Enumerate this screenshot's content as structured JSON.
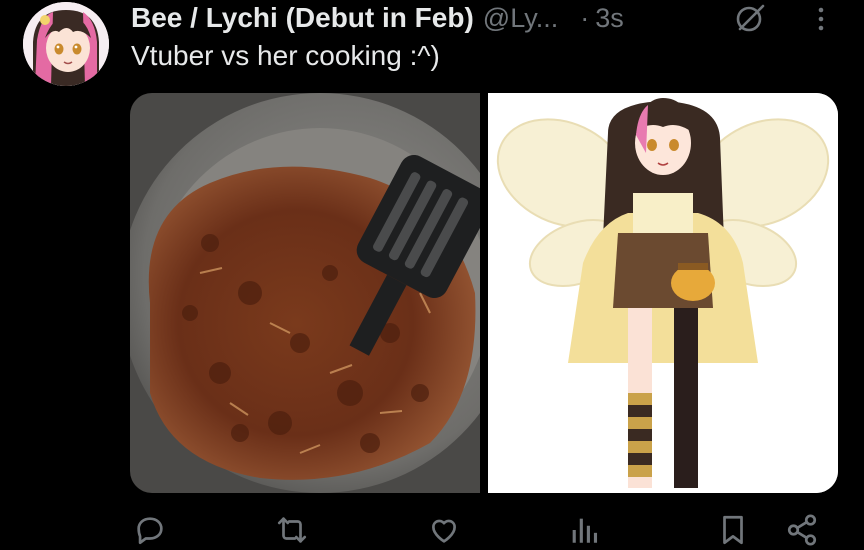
{
  "tweet": {
    "author_name": "Bee / Lychi (Debut in Feb)",
    "handle": "@Ly...",
    "separator": "·",
    "time": "3s",
    "text": "Vtuber vs her cooking :^)"
  },
  "media": {
    "images": [
      "cooking-photo",
      "vtuber-model-art"
    ]
  },
  "actions": {
    "icons": [
      "reply-icon",
      "retweet-icon",
      "like-icon",
      "views-icon",
      "bookmark-icon",
      "share-icon"
    ]
  },
  "colors": {
    "background": "#000000",
    "primary_text": "#e7e9ea",
    "secondary_text": "#71767b"
  }
}
